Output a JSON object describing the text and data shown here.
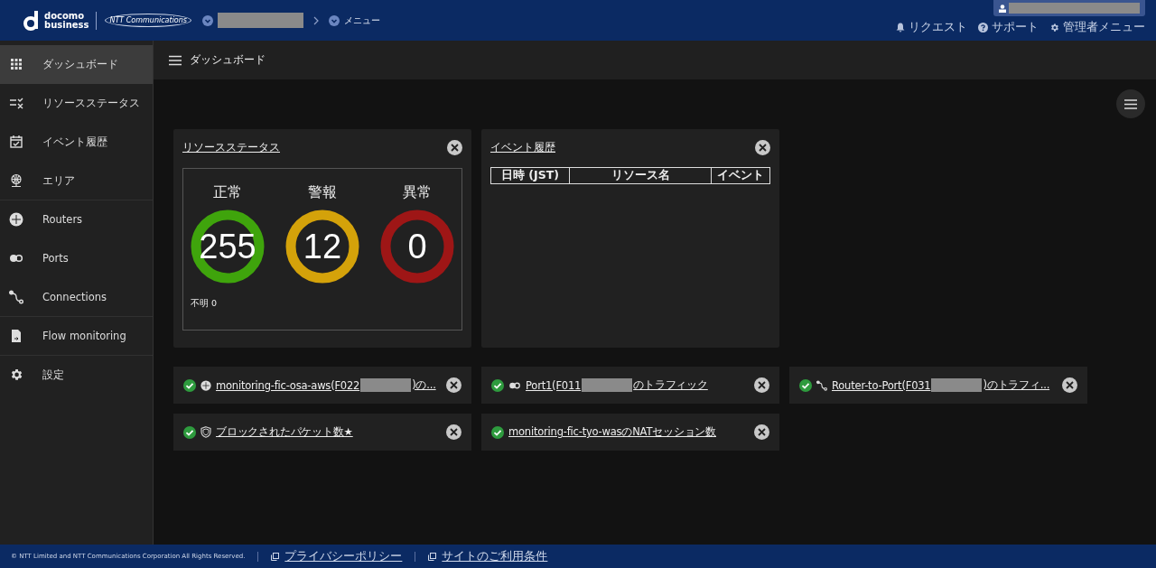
{
  "header": {
    "logo": {
      "line1": "docomo",
      "line2": "business",
      "partner": "NTT Communications"
    },
    "breadcrumb": [
      {
        "kind": "redacted"
      },
      {
        "kind": "text",
        "label": "メニュー"
      }
    ],
    "links": [
      {
        "kind": "bell",
        "label": "リクエスト"
      },
      {
        "kind": "help",
        "label": "サポート"
      },
      {
        "kind": "gear",
        "label": "管理者メニュー"
      }
    ]
  },
  "sidebar": {
    "items": [
      {
        "kind": "grid",
        "label": "ダッシュボード",
        "selected": true,
        "divider": false
      },
      {
        "kind": "checklist",
        "label": "リソースステータス",
        "selected": false,
        "divider": false
      },
      {
        "kind": "calendar",
        "label": "イベント履歴",
        "selected": false,
        "divider": false
      },
      {
        "kind": "globe",
        "label": "エリア",
        "selected": false,
        "divider": true
      },
      {
        "kind": "router",
        "label": "Routers",
        "selected": false,
        "divider": false
      },
      {
        "kind": "port",
        "label": "Ports",
        "selected": false,
        "divider": false
      },
      {
        "kind": "connection",
        "label": "Connections",
        "selected": false,
        "divider": true
      },
      {
        "kind": "file",
        "label": "Flow monitoring",
        "selected": false,
        "divider": true
      },
      {
        "kind": "gear",
        "label": "設定",
        "selected": false,
        "divider": false
      }
    ]
  },
  "page_title": "ダッシュボード",
  "resource_status": {
    "title": "リソースステータス",
    "statuses": [
      {
        "label": "正常",
        "count": "255",
        "color": "#3fa40c"
      },
      {
        "label": "警報",
        "count": "12",
        "color": "#d4a20a"
      },
      {
        "label": "異常",
        "count": "0",
        "color": "#9e1616"
      }
    ],
    "unknown": "不明 0"
  },
  "event_history": {
    "title": "イベント履歴",
    "columns": [
      "日時 (JST)",
      "リソース名",
      "イベント"
    ]
  },
  "widgets": [
    {
      "kind": "router",
      "prefix": "monitoring-fic-osa-aws(F022",
      "suffix": ")の...",
      "redacted": true
    },
    {
      "kind": "port",
      "prefix": "Port1(F011",
      "suffix": "のトラフィック",
      "redacted": true
    },
    {
      "kind": "connection",
      "prefix": "Router-to-Port(F031",
      "suffix": ")のトラフィ...",
      "redacted": true
    },
    {
      "kind": "shield",
      "prefix": "ブロックされたパケット数★",
      "redacted": false
    },
    {
      "kind": "none",
      "prefix": "monitoring-fic-tyo-wasのNATセッション数",
      "redacted": false
    }
  ],
  "footer": {
    "copyright": "© NTT Limited and NTT Communications Corporation All Rights Reserved.",
    "links": [
      "プライバシーポリシー",
      "サイトのご利用条件"
    ]
  }
}
